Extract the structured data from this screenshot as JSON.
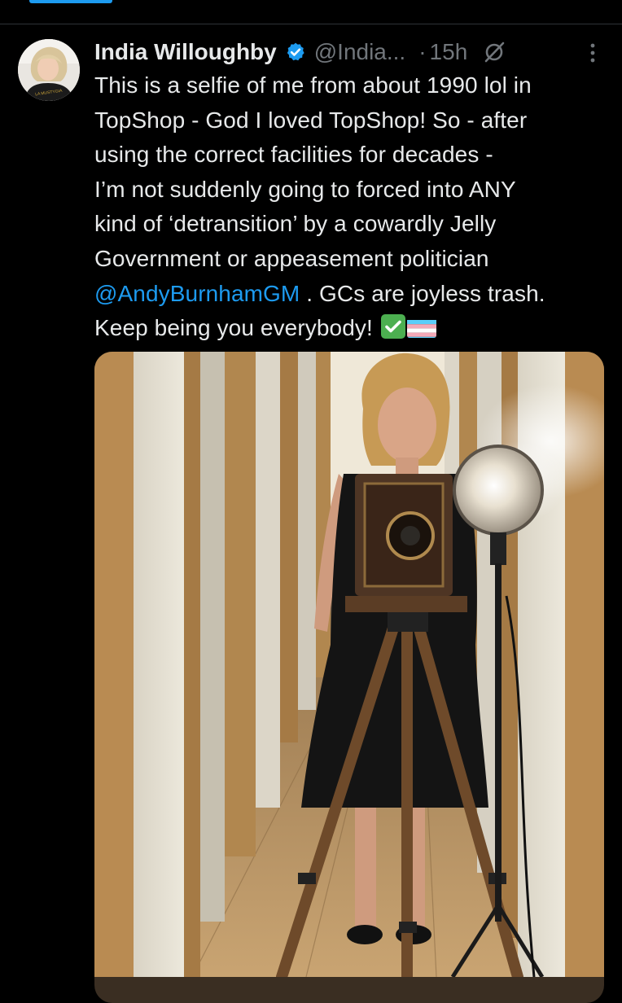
{
  "author": {
    "name": "India Willoughby",
    "handle": "@India...",
    "separator": "·",
    "time": "15h",
    "verified_color": "#1d9bf0"
  },
  "tweet": {
    "lines": [
      "This is a selfie of me from about 1990 lol in",
      "TopShop - God I loved TopShop! So - after",
      "using the correct facilities for decades -",
      "I’m not suddenly going to forced into ANY",
      "kind of ‘detransition’ by a cowardly Jelly",
      "Government or appeasement politician"
    ],
    "mention": "@AndyBurnhamGM",
    "after_mention": " . GCs are joyless trash.",
    "last_line": "Keep being you everybody! ",
    "emojis": [
      "check-mark-button-emoji",
      "transgender-flag-emoji"
    ]
  },
  "avatar_shirt_text": "LA MUSTYGIA",
  "colors": {
    "background": "#000000",
    "text": "#e7e9ea",
    "muted": "#71767b",
    "accent": "#1d9bf0"
  },
  "icons": [
    "verified-badge-icon",
    "grok-icon",
    "more-options-icon"
  ]
}
